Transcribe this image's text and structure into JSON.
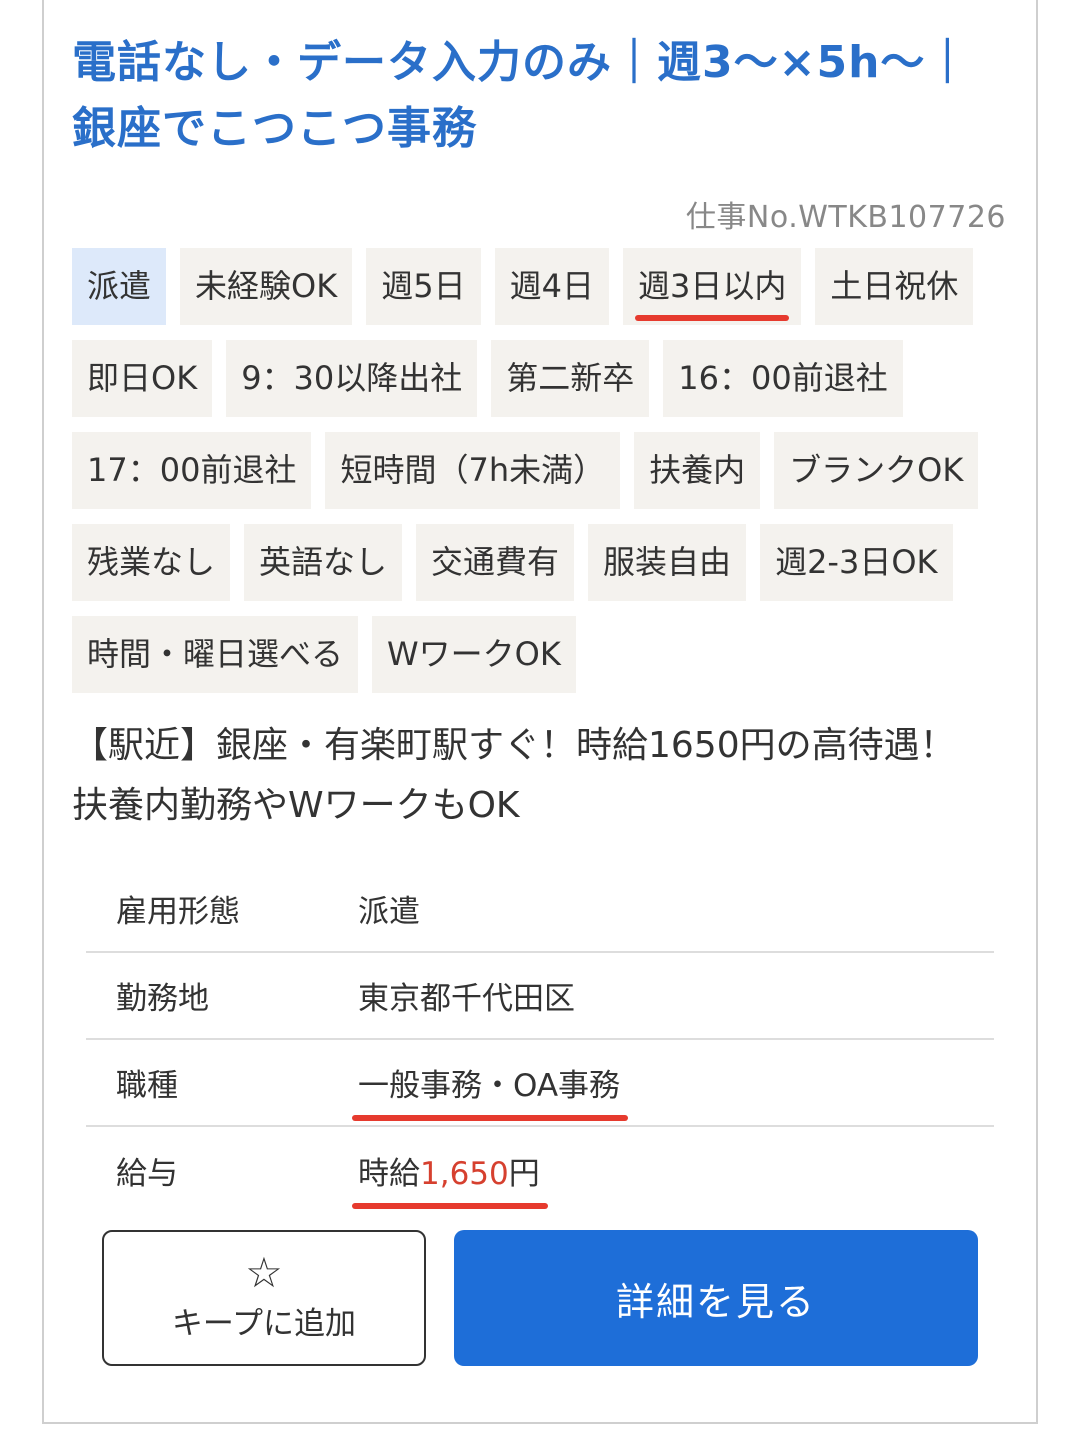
{
  "job": {
    "title": "電話なし・データ入力のみ｜週3〜×5h〜｜銀座でこつこつ事務",
    "job_no": "仕事No.WTKB107726",
    "tags": [
      {
        "label": "派遣",
        "primary": true,
        "marked": false
      },
      {
        "label": "未経験OK",
        "primary": false,
        "marked": false
      },
      {
        "label": "週5日",
        "primary": false,
        "marked": false
      },
      {
        "label": "週4日",
        "primary": false,
        "marked": false
      },
      {
        "label": "週3日以内",
        "primary": false,
        "marked": true
      },
      {
        "label": "土日祝休",
        "primary": false,
        "marked": false
      },
      {
        "label": "即日OK",
        "primary": false,
        "marked": false
      },
      {
        "label": "9：30以降出社",
        "primary": false,
        "marked": false
      },
      {
        "label": "第二新卒",
        "primary": false,
        "marked": false
      },
      {
        "label": "16：00前退社",
        "primary": false,
        "marked": false
      },
      {
        "label": "17：00前退社",
        "primary": false,
        "marked": false
      },
      {
        "label": "短時間（7h未満）",
        "primary": false,
        "marked": false
      },
      {
        "label": "扶養内",
        "primary": false,
        "marked": false
      },
      {
        "label": "ブランクOK",
        "primary": false,
        "marked": false
      },
      {
        "label": "残業なし",
        "primary": false,
        "marked": false
      },
      {
        "label": "英語なし",
        "primary": false,
        "marked": false
      },
      {
        "label": "交通費有",
        "primary": false,
        "marked": false
      },
      {
        "label": "服装自由",
        "primary": false,
        "marked": false
      },
      {
        "label": "週2-3日OK",
        "primary": false,
        "marked": false
      },
      {
        "label": "時間・曜日選べる",
        "primary": false,
        "marked": false
      },
      {
        "label": "WワークOK",
        "primary": false,
        "marked": false
      }
    ],
    "lead": "【駅近】銀座・有楽町駅すぐ！時給1650円の高待遇！扶養内勤務やWワークもOK",
    "info": {
      "employment_label": "雇用形態",
      "employment_value": "派遣",
      "location_label": "勤務地",
      "location_value": "東京都千代田区",
      "category_label": "職種",
      "category_value": "一般事務・OA事務",
      "salary_label": "給与",
      "salary_prefix": "時給",
      "salary_amount": "1,650",
      "salary_suffix": "円"
    },
    "keep_button": {
      "icon": "star-outline-icon",
      "label": "キープに追加"
    },
    "detail_button": {
      "label": "詳細を見る"
    }
  },
  "colors": {
    "title_blue": "#2a6fc9",
    "button_blue": "#1e6ed8",
    "tag_bg": "#f4f2ee",
    "tag_primary_bg": "#dde9fa",
    "wage_red": "#d6402f",
    "marker_red": "#e63a2e"
  }
}
